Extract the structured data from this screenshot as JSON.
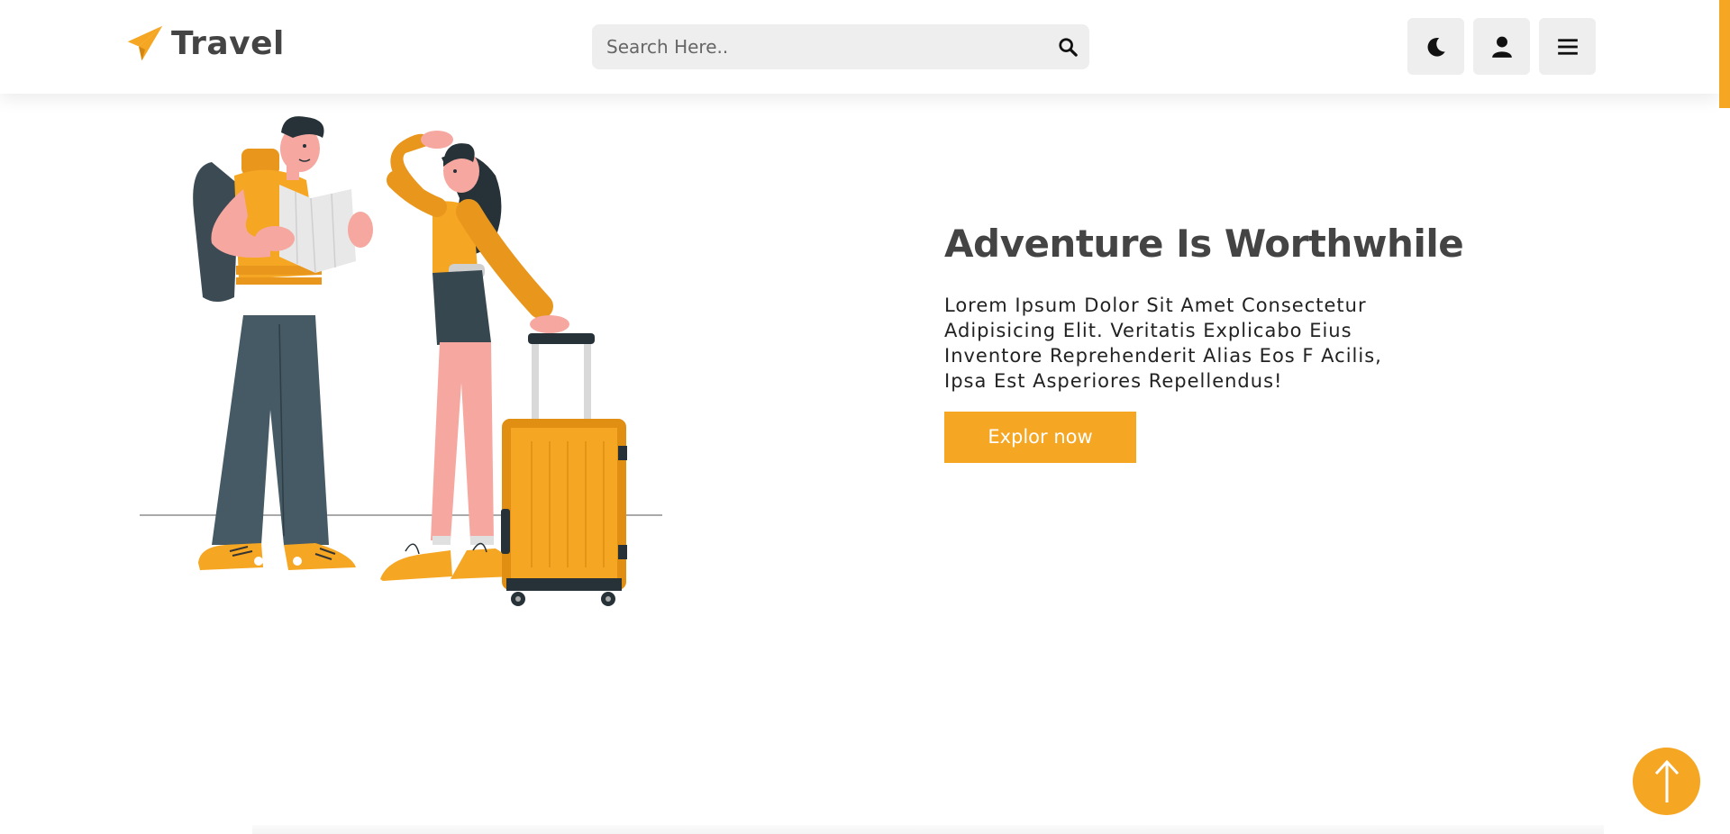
{
  "header": {
    "logo_text": "Travel",
    "logo_icon": "paper-plane-icon",
    "search": {
      "placeholder": "Search Here..",
      "value": "",
      "icon": "search-icon"
    },
    "buttons": [
      {
        "icon": "moon-icon",
        "name": "theme-toggle"
      },
      {
        "icon": "user-icon",
        "name": "user-account"
      },
      {
        "icon": "hamburger-icon",
        "name": "menu"
      }
    ]
  },
  "hero": {
    "title": "Adventure Is Worthwhile",
    "text": "Lorem Ipsum Dolor Sit Amet Consectetur Adipisicing Elit. Veritatis Explicabo Eius Inventore Reprehenderit Alias Eos F Acilis, Ipsa Est Asperiores Repellendus!",
    "button_label": "Explor now",
    "illustration": "travelers-with-map-and-suitcase"
  },
  "scroll_top": {
    "icon": "arrow-up-icon"
  },
  "colors": {
    "accent": "#f5a623",
    "text_dark": "#444444",
    "button_bg": "#eeeeee"
  }
}
